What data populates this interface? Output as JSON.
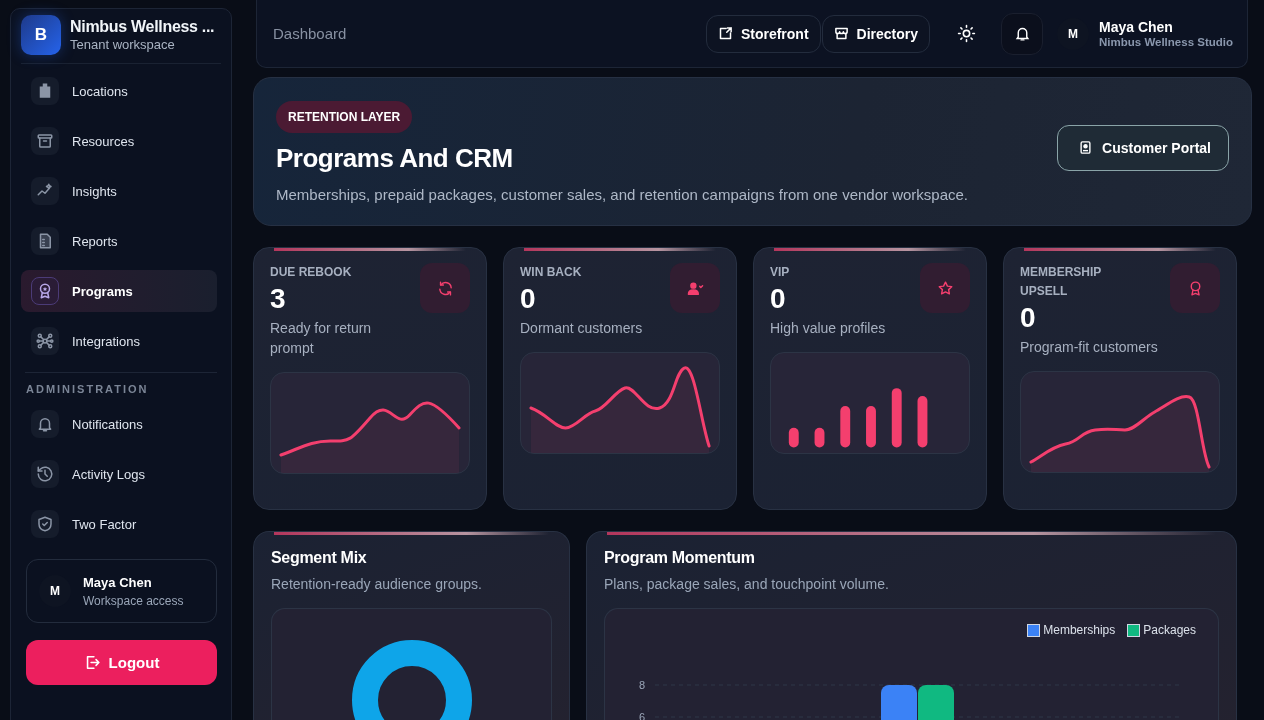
{
  "sidebar": {
    "brand": {
      "initial": "B",
      "name": "Nimbus Wellness ...",
      "subtitle": "Tenant workspace"
    },
    "nav": [
      {
        "label": "Locations",
        "selected": false
      },
      {
        "label": "Resources",
        "selected": false
      },
      {
        "label": "Insights",
        "selected": false
      },
      {
        "label": "Reports",
        "selected": false
      },
      {
        "label": "Programs",
        "selected": true
      },
      {
        "label": "Integrations",
        "selected": false
      }
    ],
    "section_title": "ADMINISTRATION",
    "admin_nav": [
      {
        "label": "Notifications",
        "selected": false
      },
      {
        "label": "Activity Logs",
        "selected": false
      },
      {
        "label": "Two Factor",
        "selected": false
      }
    ],
    "user": {
      "initial": "M",
      "name": "Maya Chen",
      "role": "Workspace access"
    },
    "logout": "Logout"
  },
  "header": {
    "breadcrumb": "Dashboard",
    "links": [
      "Storefront",
      "Directory"
    ],
    "user": {
      "initial": "M",
      "name": "Maya Chen",
      "org": "Nimbus Wellness Studio"
    }
  },
  "hero": {
    "badge": "RETENTION LAYER",
    "title": "Programs And CRM",
    "description": "Memberships, prepaid packages, customer sales, and retention campaigns from one vendor workspace.",
    "button": "Customer Portal"
  },
  "stats": [
    {
      "label": "DUE REBOOK",
      "value": "3",
      "description": "Ready for return prompt",
      "kind": "line"
    },
    {
      "label": "WIN BACK",
      "value": "0",
      "description": "Dormant customers",
      "kind": "line"
    },
    {
      "label": "VIP",
      "value": "0",
      "description": "High value profiles",
      "kind": "bars"
    },
    {
      "label": "MEMBERSHIP UPSELL",
      "value": "0",
      "description": "Program-fit customers",
      "kind": "line"
    }
  ],
  "segment_mix": {
    "title": "Segment Mix",
    "subtitle": "Retention-ready audience groups."
  },
  "program_momentum": {
    "title": "Program Momentum",
    "subtitle": "Plans, package sales, and touchpoint volume.",
    "chart_data": {
      "type": "bar",
      "legend": "top-right",
      "ylim": [
        0,
        8
      ],
      "yticks": [
        6,
        8
      ],
      "series": [
        {
          "name": "Memberships",
          "color": "#3b82f6",
          "values": [
            8
          ]
        },
        {
          "name": "Packages",
          "color": "#10b981",
          "values": [
            8
          ]
        }
      ]
    }
  }
}
